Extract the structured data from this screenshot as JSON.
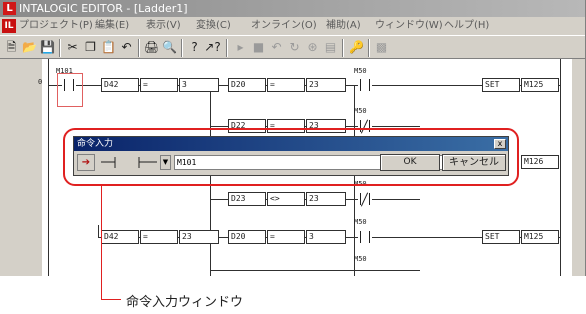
{
  "window": {
    "title": "INTALOGIC EDITOR - [Ladder1]",
    "app_icon": "L"
  },
  "menu": {
    "icon": "IL",
    "items": [
      "プロジェクト(P)",
      "編集(E)",
      "表示(V)",
      "変換(C)",
      "オンライン(O)",
      "補助(A)",
      "ウィンドウ(W)",
      "ヘルプ(H)"
    ]
  },
  "toolbar": {
    "icons": [
      "new-file-icon",
      "open-folder-icon",
      "save-icon",
      "cut-icon",
      "copy-icon",
      "paste-icon",
      "undo-icon",
      "print-icon",
      "print-preview-icon",
      "help-icon",
      "context-help-icon",
      "run-icon",
      "stop-icon",
      "step-icon",
      "monitor-icon",
      "compare-icon",
      "list-icon",
      "key-icon",
      "window-icon"
    ]
  },
  "ladder": {
    "step_number": "0",
    "rungs": [
      {
        "contact": "M101",
        "cells": [
          "D42",
          "=",
          "3"
        ],
        "compare": [
          "D20",
          "=",
          "23"
        ],
        "out_contact": "M50",
        "coil": [
          "SET",
          "M125"
        ]
      },
      {
        "out_contact": "M50",
        "compare": [
          "D22",
          "=",
          "23"
        ]
      },
      {
        "out_contact": "M50",
        "compare": [
          "D23",
          "<>",
          "23"
        ]
      },
      {
        "cells": [
          "D42",
          "=",
          "23"
        ],
        "compare": [
          "D20",
          "=",
          "3"
        ],
        "out_contact": "M50",
        "coil": [
          "SET",
          "M125"
        ]
      },
      {
        "out_contact": "M50"
      }
    ],
    "partial_coil": "M126"
  },
  "dialog": {
    "title": "命令入力",
    "close": "x",
    "input_value": "M101",
    "ok_label": "OK",
    "cancel_label": "キャンセル"
  },
  "callout": {
    "label": "命令入力ウィンドウ",
    "color": "#e02020"
  }
}
